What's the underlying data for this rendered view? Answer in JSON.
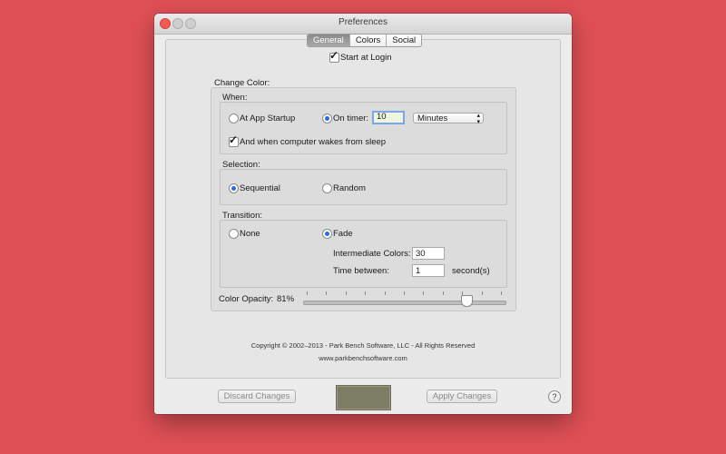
{
  "window": {
    "title": "Preferences"
  },
  "tabs": [
    {
      "label": "General",
      "active": true
    },
    {
      "label": "Colors",
      "active": false
    },
    {
      "label": "Social",
      "active": false
    }
  ],
  "start_at_login": {
    "label": "Start at Login",
    "checked": true
  },
  "change_color": {
    "title": "Change Color:",
    "when": {
      "title": "When:",
      "at_app_startup": {
        "label": "At App Startup",
        "selected": false
      },
      "on_timer": {
        "label": "On timer:",
        "selected": true,
        "value": "10",
        "unit": "Minutes"
      },
      "wakes_from_sleep": {
        "label": "And when computer wakes from sleep",
        "checked": true
      }
    },
    "selection": {
      "title": "Selection:",
      "sequential": {
        "label": "Sequential",
        "selected": true
      },
      "random": {
        "label": "Random",
        "selected": false
      }
    },
    "transition": {
      "title": "Transition:",
      "none": {
        "label": "None",
        "selected": false
      },
      "fade": {
        "label": "Fade",
        "selected": true
      },
      "intermediate_colors": {
        "label": "Intermediate Colors:",
        "value": "30"
      },
      "time_between": {
        "label": "Time between:",
        "value": "1",
        "unit": "second(s)"
      }
    },
    "opacity": {
      "label": "Color Opacity:",
      "value_text": "81%",
      "value": 81
    }
  },
  "footer": {
    "copyright": "Copyright © 2002–2013 - Park Bench Software, LLC - All Rights Reserved",
    "website": "www.parkbenchsoftware.com"
  },
  "buttons": {
    "discard": "Discard Changes",
    "apply": "Apply Changes",
    "help": "?"
  },
  "colors": {
    "desktop_background": "#df5056",
    "preview_swatch": "#7d7d66",
    "selection_accent": "#2a6bd8"
  },
  "icons": {
    "window_close": "close-icon",
    "window_minimize": "minimize-icon",
    "window_zoom": "zoom-icon",
    "help": "help-icon",
    "select_arrows": "chevron-updown-icon"
  }
}
